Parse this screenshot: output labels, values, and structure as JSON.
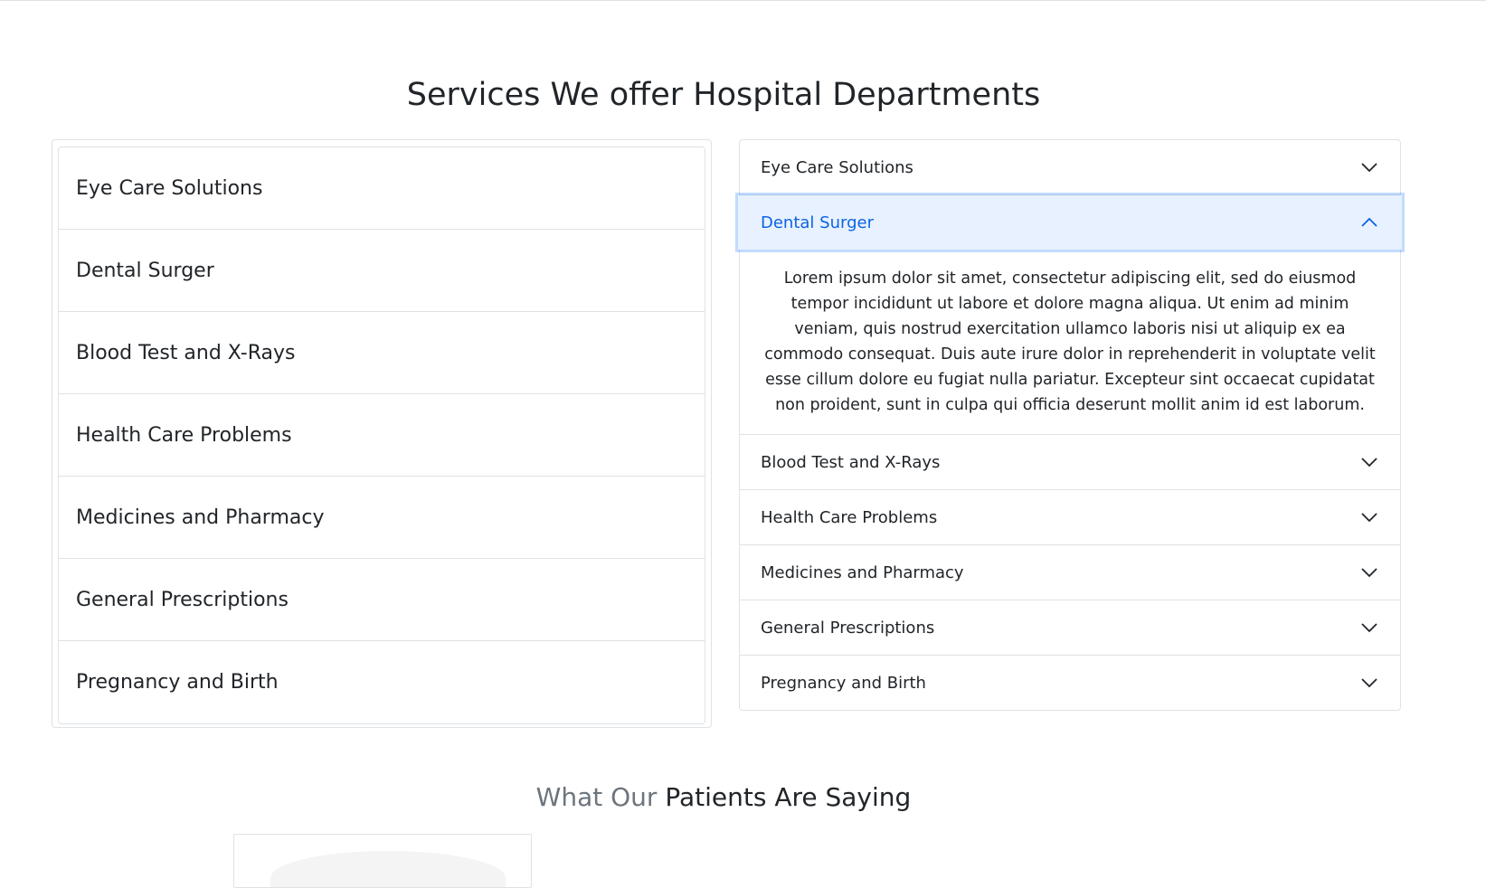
{
  "page": {
    "section_title": "Services We offer Hospital Departments",
    "testimonial_title_muted": "What Our",
    "testimonial_title_strong": "Patients Are Saying"
  },
  "list": {
    "items": [
      {
        "label": "Eye Care Solutions"
      },
      {
        "label": "Dental Surger"
      },
      {
        "label": "Blood Test and X-Rays"
      },
      {
        "label": "Health Care Problems"
      },
      {
        "label": "Medicines and Pharmacy"
      },
      {
        "label": "General Prescriptions"
      },
      {
        "label": "Pregnancy and Birth"
      }
    ]
  },
  "accordion": {
    "items": [
      {
        "label": "Eye Care Solutions",
        "expanded": false,
        "icon": "chevron-down-icon"
      },
      {
        "label": "Dental Surger",
        "expanded": true,
        "icon": "chevron-up-icon",
        "body": "Lorem ipsum dolor sit amet, consectetur adipiscing elit, sed do eiusmod tempor incididunt ut labore et dolore magna aliqua. Ut enim ad minim veniam, quis nostrud exercitation ullamco laboris nisi ut aliquip ex ea commodo consequat. Duis aute irure dolor in reprehenderit in voluptate velit esse cillum dolore eu fugiat nulla pariatur. Excepteur sint occaecat cupidatat non proident, sunt in culpa qui officia deserunt mollit anim id est laborum."
      },
      {
        "label": "Blood Test and X-Rays",
        "expanded": false,
        "icon": "chevron-down-icon"
      },
      {
        "label": "Health Care Problems",
        "expanded": false,
        "icon": "chevron-down-icon"
      },
      {
        "label": "Medicines and Pharmacy",
        "expanded": false,
        "icon": "chevron-down-icon"
      },
      {
        "label": "General Prescriptions",
        "expanded": false,
        "icon": "chevron-down-icon"
      },
      {
        "label": "Pregnancy and Birth",
        "expanded": false,
        "icon": "chevron-down-icon"
      }
    ]
  },
  "colors": {
    "active_text": "#0c63e4",
    "active_bg": "#e7f1ff",
    "border": "#dee2e6",
    "muted": "#6c757d"
  }
}
